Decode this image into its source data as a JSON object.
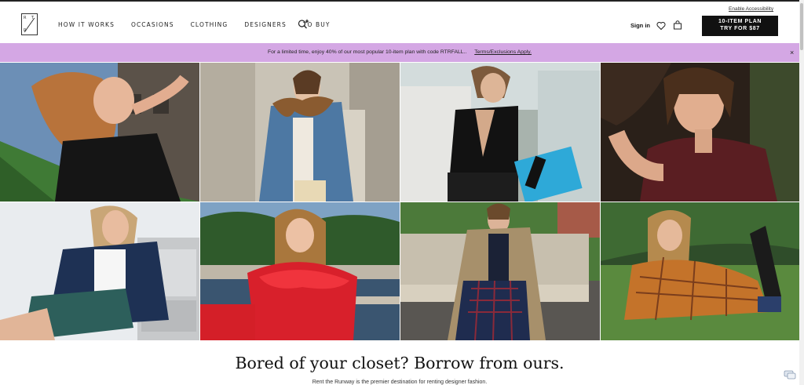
{
  "header": {
    "nav": [
      "HOW IT WORKS",
      "OCCASIONS",
      "CLOTHING",
      "DESIGNERS",
      "TO BUY"
    ],
    "search_icon": "sparkle-search-icon",
    "accessibility_link": "Enable Accessibility",
    "sign_in": "Sign in",
    "heart_icon": "heart-icon",
    "bag_icon": "shopping-bag-icon",
    "cta_line1": "10-ITEM PLAN",
    "cta_line2": "TRY FOR $87"
  },
  "promo": {
    "text": "For a limited time, enjoy 40% of our most popular 10-item plan with code RTRFALL..",
    "link": "Terms/Exclusions Apply.",
    "close": "×",
    "background": "#d4a7e4"
  },
  "hero": {
    "heading": "Bored of your closet? Borrow from ours.",
    "subtext": "Rent the Runway is the premier destination for renting designer fashion."
  },
  "photos": [
    {
      "subject": "woman-black-bow-top-on-grass"
    },
    {
      "subject": "woman-denim-jacket-fur-collar"
    },
    {
      "subject": "woman-black-crossover-top"
    },
    {
      "subject": "woman-burgundy-satin-top"
    },
    {
      "subject": "woman-navy-blazer-by-printer"
    },
    {
      "subject": "woman-red-ruffle-dress-by-pond"
    },
    {
      "subject": "woman-trench-coat-plaid-skirt-on-bench"
    },
    {
      "subject": "woman-plaid-coat-on-lawn"
    }
  ],
  "chat_icon": "chat-icon"
}
